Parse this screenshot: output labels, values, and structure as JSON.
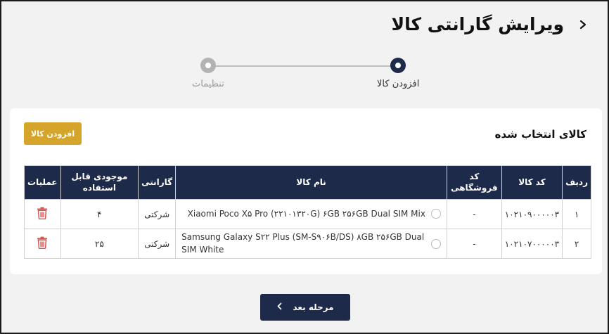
{
  "header": {
    "title": "ویرایش گارانتی کالا"
  },
  "stepper": {
    "steps": [
      {
        "label": "افزودن کالا",
        "state": "active"
      },
      {
        "label": "تنظیمات",
        "state": "inactive"
      }
    ]
  },
  "card": {
    "title": "کالای انتخاب شده",
    "add_button": "افزودن کالا"
  },
  "table": {
    "headers": [
      "ردیف",
      "کد کالا",
      "کد فروشگاهی",
      "نام کالا",
      "گارانتی",
      "موجودی قابل استفاده",
      "عملیات"
    ],
    "rows": [
      {
        "row": "۱",
        "code": "۱۰۲۱۰۹۰۰۰۰۰۳",
        "store_code": "-",
        "name": "Xiaomi Poco X۵ Pro (۲۲۱۰۱۳۲۰G) ۶GB ۲۵۶GB Dual SIM Mix",
        "warranty": "شرکتی",
        "stock": "۴"
      },
      {
        "row": "۲",
        "code": "۱۰۲۱۰۷۰۰۰۰۰۳",
        "store_code": "-",
        "name": "Samsung Galaxy S۲۲ Plus (SM-S۹۰۶B/DS) ۸GB ۲۵۶GB Dual SIM White",
        "warranty": "شرکتی",
        "stock": "۲۵"
      }
    ]
  },
  "footer": {
    "next_button": "مرحله بعد"
  },
  "colors": {
    "primary": "#1d2a4a",
    "accent": "#d4a52a",
    "danger": "#d9534f"
  },
  "icons": {
    "back": "chevron-right-icon",
    "next": "chevron-left-icon",
    "delete": "trash-icon"
  }
}
